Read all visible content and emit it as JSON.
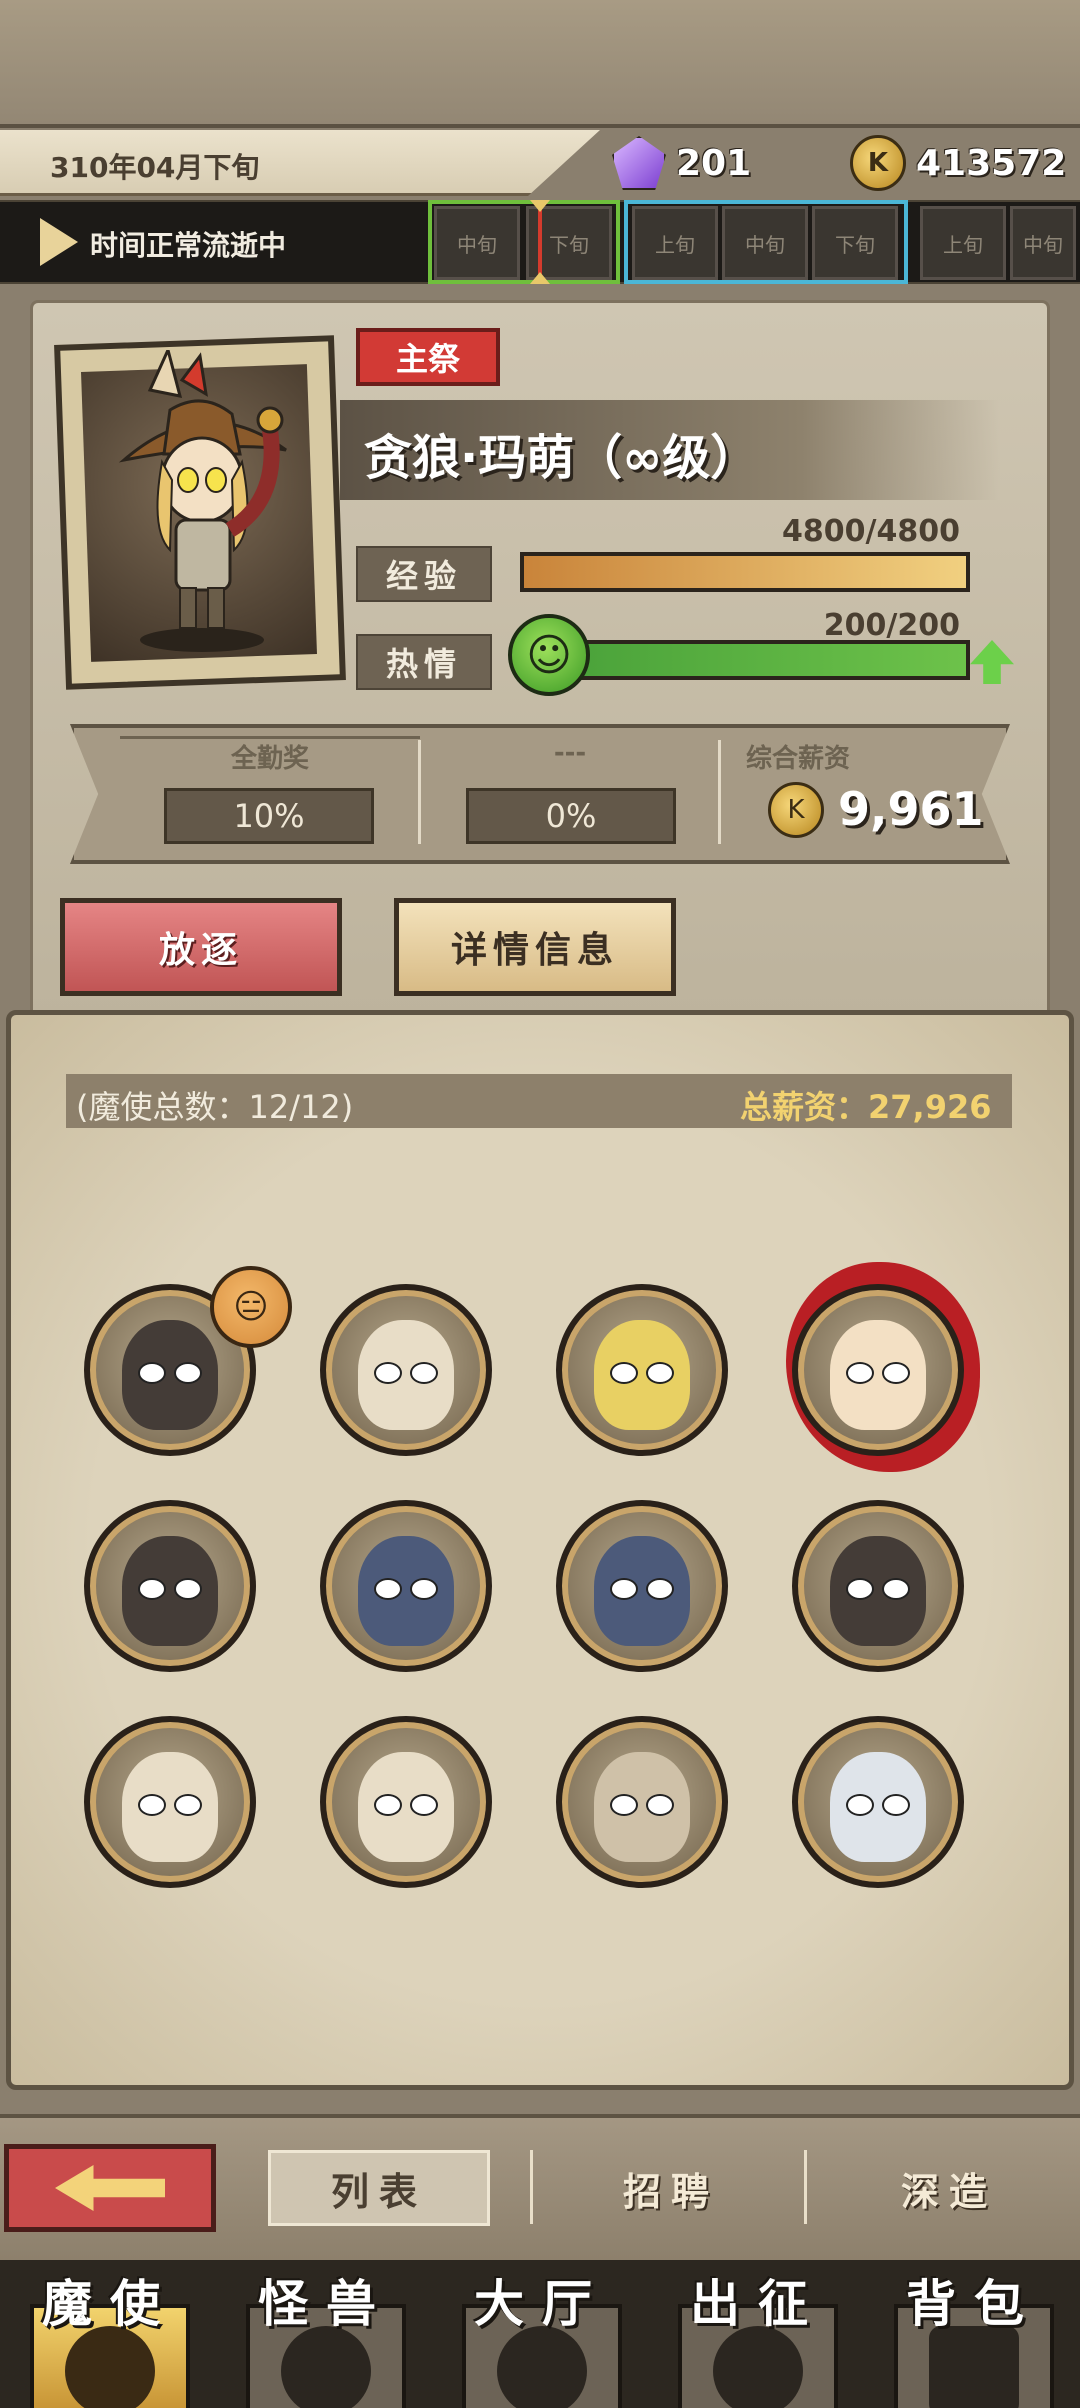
{
  "header": {
    "date": "310年04月下旬",
    "gems": "201",
    "coins": "413572",
    "coin_symbol": "K"
  },
  "timeline": {
    "status": "时间正常流逝中",
    "slots": [
      "中旬",
      "下旬",
      "上旬",
      "中旬",
      "下旬",
      "上旬",
      "中旬"
    ]
  },
  "character": {
    "role_tag": "主祭",
    "name": "贪狼·玛萌（∞级）",
    "exp_label": "经验",
    "exp_value": "4800/4800",
    "exp_ratio": 1.0,
    "passion_label": "热情",
    "passion_value": "200/200",
    "passion_ratio": 1.0,
    "passion_face": "☺",
    "bonus_title": "全勤奖",
    "bonus_value": "10%",
    "extra_title": "---",
    "extra_value": "0%",
    "salary_title": "综合薪资",
    "salary_value": "9,961"
  },
  "buttons": {
    "exile": "放逐",
    "details": "详情信息"
  },
  "list": {
    "count_label": "(魔使总数：12/12)",
    "total_label": "总薪资：27,926",
    "mood_face": "😑"
  },
  "tabs": {
    "list": "列表",
    "recruit": "招聘",
    "forge": "深造"
  },
  "nav": {
    "envoy": "魔使",
    "monster": "怪兽",
    "hall": "大厅",
    "expedition": "出征",
    "bag": "背包"
  },
  "colors": {
    "accent_red": "#d23a35",
    "exp_bar": "#e7b55a",
    "passion_bar": "#5fb23f",
    "gold_text": "#f2d270"
  }
}
